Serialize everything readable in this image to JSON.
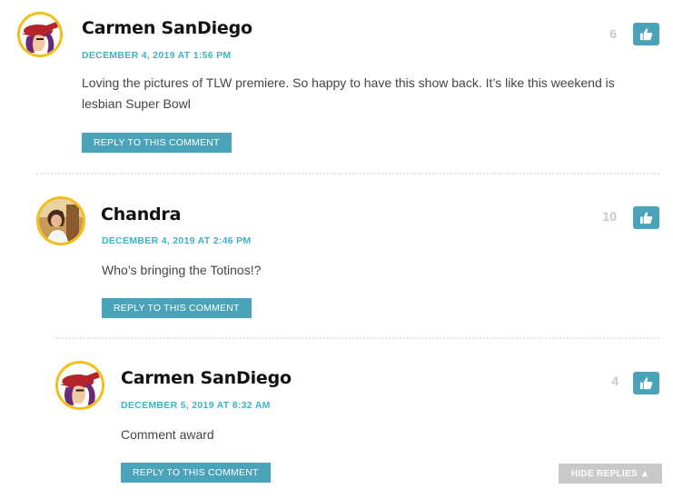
{
  "comments": [
    {
      "author": "Carmen SanDiego",
      "date": "DECEMBER 4, 2019 AT 1:56 PM",
      "text": "Loving the pictures of TLW premiere. So happy to have this show back. It’s like this weekend is lesbian Super Bowl",
      "reply_label": "REPLY TO THIS COMMENT",
      "likes": "6",
      "avatar_icon": "carmen-sandiego-avatar"
    },
    {
      "author": "Chandra",
      "date": "DECEMBER 4, 2019 AT 2:46 PM",
      "text": "Who’s bringing the Totinos!?",
      "reply_label": "REPLY TO THIS COMMENT",
      "likes": "10",
      "avatar_icon": "photo-avatar"
    },
    {
      "author": "Carmen SanDiego",
      "date": "DECEMBER 5, 2019 AT 8:32 AM",
      "text": "Comment award",
      "reply_label": "REPLY TO THIS COMMENT",
      "likes": "4",
      "avatar_icon": "carmen-sandiego-avatar"
    }
  ],
  "hide_replies_label": "HIDE REPLIES ▲",
  "colors": {
    "accent": "#4aa3b8",
    "date": "#3fb3c4",
    "avatar_border": "#f2be1c",
    "hide_replies_bg": "#c9c9c9"
  }
}
